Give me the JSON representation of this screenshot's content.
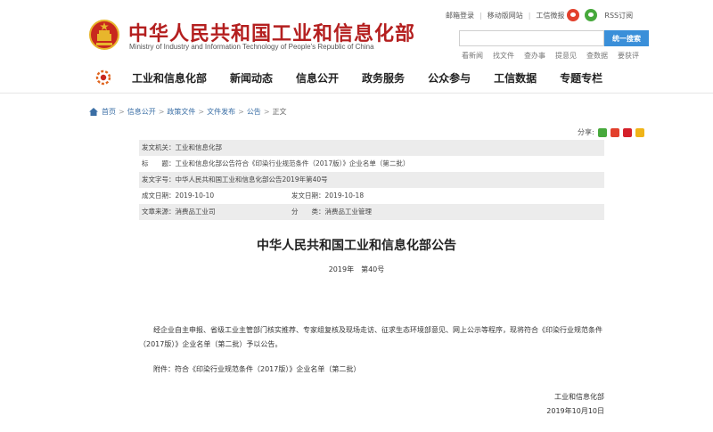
{
  "header": {
    "site_title": "中华人民共和国工业和信息化部",
    "site_subtitle": "Ministry of Industry and Information Technology of People’s Republic of China",
    "toplinks": [
      "邮箱登录",
      "移动版网站",
      "工信微报"
    ],
    "rss": "RSS订阅",
    "search": {
      "placeholder": "",
      "button": "统一搜索"
    },
    "quick_links": [
      "看新闻",
      "找文件",
      "查办事",
      "提意见",
      "查数据",
      "要获评"
    ]
  },
  "nav": {
    "items": [
      "工业和信息化部",
      "新闻动态",
      "信息公开",
      "政务服务",
      "公众参与",
      "工信数据",
      "专题专栏"
    ]
  },
  "breadcrumb": [
    "首页",
    "信息公开",
    "政策文件",
    "文件发布",
    "公告"
  ],
  "breadcrumb_current": "正文",
  "share_label": "分享:",
  "info": {
    "issuer": "发文机关：工业和信息化部",
    "title": "标　　题：工业和信息化部公告符合《印染行业规范条件（2017版）》企业名单（第二批）",
    "doc_no": "发文字号：中华人民共和国工业和信息化部公告2019年第40号",
    "created": "成文日期：2019-10-10",
    "published": "发文日期：2019-10-18",
    "source": "文章来源：消费品工业司",
    "category": "分　　类：消费品工业管理"
  },
  "document": {
    "title": "中华人民共和国工业和信息化部公告",
    "number": "2019年　第40号",
    "body": "经企业自主申报、省级工业主管部门核实推荐、专家组复核及现场走访、征求生态环境部意见、网上公示等程序，现将符合《印染行业规范条件（2017版）》企业名单（第二批）予以公告。",
    "attachment": "附件：符合《印染行业规范条件（2017版）》企业名单（第二批）",
    "signature": "工业和信息化部",
    "date": "2019年10月10日"
  },
  "colors": {
    "brand_red": "#b41f1f",
    "search_blue": "#3a8fd9",
    "link_blue": "#3a6ea5"
  }
}
